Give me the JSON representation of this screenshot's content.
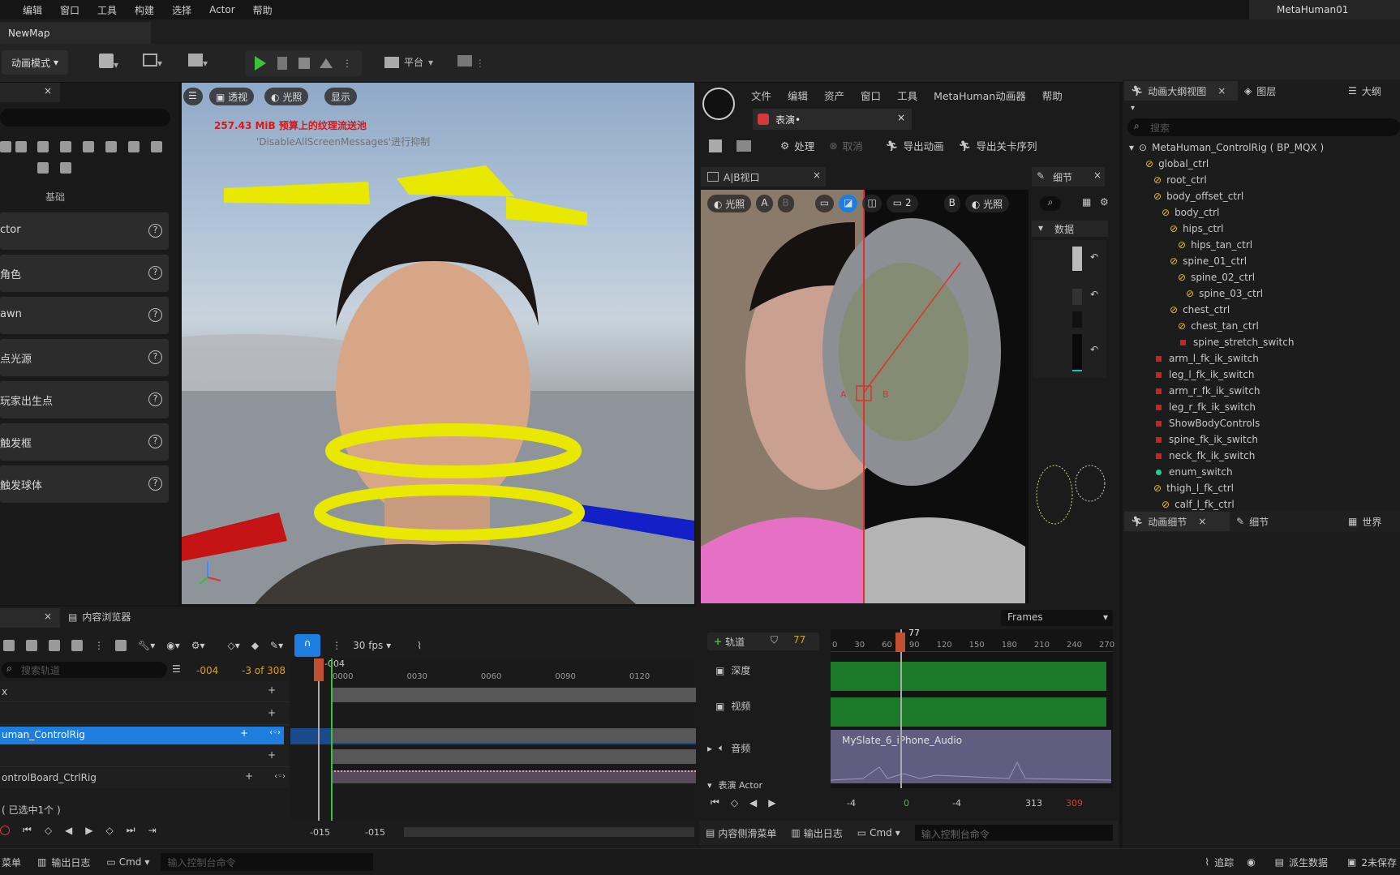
{
  "menu": [
    "编辑",
    "窗口",
    "工具",
    "构建",
    "选择",
    "Actor",
    "帮助"
  ],
  "app": {
    "map_tab": "NewMap",
    "project": "MetaHuman01"
  },
  "toolbar": {
    "mode": "动画模式",
    "platform": "平台"
  },
  "left_panel": {
    "section_label": "基础",
    "items": [
      "ctor",
      "角色",
      "awn",
      "点光源",
      "玩家出生点",
      "触发框",
      "触发球体"
    ],
    "help_glyph": "?"
  },
  "viewport": {
    "buttons": {
      "perspective": "透视",
      "lighting": "光照",
      "show": "显示"
    },
    "warning": "257.43 MiB 预算上的纹理流送池",
    "warning_sub": "'DisableAllScreenMessages'进行抑制"
  },
  "mh_window": {
    "menu": [
      "文件",
      "编辑",
      "资产",
      "窗口",
      "工具",
      "MetaHuman动画器",
      "帮助"
    ],
    "tab": "表演•",
    "toolbar": {
      "process": "处理",
      "cancel": "取消",
      "export_anim": "导出动画",
      "export_seq": "导出关卡序列"
    },
    "ab_tab": "A|B视口",
    "ab_buttons": {
      "lighting_a": "光照",
      "a": "A",
      "b_small": "B",
      "count": "2",
      "b": "B",
      "lighting_b": "光照"
    },
    "labels_ab": {
      "a": "A",
      "b": "B"
    },
    "details_tab": "细节",
    "details_section": "数据",
    "frames_dropdown": "Frames",
    "track_btn": "轨道",
    "frame_num": "77",
    "playhead": "77",
    "ticks": [
      "0",
      "30",
      "60",
      "90",
      "120",
      "150",
      "180",
      "210",
      "240",
      "270"
    ],
    "tracks": {
      "depth": "深度",
      "video": "视频",
      "audio": "音频",
      "actor": "表演 Actor"
    },
    "audio_clip": "MySlate_6_iPhone_Audio",
    "footer_vals": {
      "a": "-4",
      "b": "0",
      "c": "-4",
      "d": "313",
      "e": "309"
    },
    "bottom": {
      "content_menu": "内容侧滑菜单",
      "output_log": "输出日志",
      "cmd": "Cmd",
      "console_ph": "输入控制台命令"
    }
  },
  "outliner": {
    "tab1": "动画大纲视图",
    "tab2": "图层",
    "tab3": "大纲",
    "search_ph": "搜索",
    "root": "MetaHuman_ControlRig ( BP_MQX )",
    "items": [
      {
        "label": "global_ctrl",
        "indent": 1,
        "type": "ctrl"
      },
      {
        "label": "root_ctrl",
        "indent": 2,
        "type": "ctrl"
      },
      {
        "label": "body_offset_ctrl",
        "indent": 2,
        "type": "ctrl"
      },
      {
        "label": "body_ctrl",
        "indent": 3,
        "type": "ctrl"
      },
      {
        "label": "hips_ctrl",
        "indent": 4,
        "type": "ctrl"
      },
      {
        "label": "hips_tan_ctrl",
        "indent": 5,
        "type": "ctrl"
      },
      {
        "label": "spine_01_ctrl",
        "indent": 4,
        "type": "ctrl"
      },
      {
        "label": "spine_02_ctrl",
        "indent": 5,
        "type": "ctrl"
      },
      {
        "label": "spine_03_ctrl",
        "indent": 6,
        "type": "ctrl"
      },
      {
        "label": "chest_ctrl",
        "indent": 4,
        "type": "ctrl"
      },
      {
        "label": "chest_tan_ctrl",
        "indent": 5,
        "type": "ctrl"
      },
      {
        "label": "spine_stretch_switch",
        "indent": 5,
        "type": "red"
      },
      {
        "label": "arm_l_fk_ik_switch",
        "indent": 2,
        "type": "red"
      },
      {
        "label": "leg_l_fk_ik_switch",
        "indent": 2,
        "type": "red"
      },
      {
        "label": "arm_r_fk_ik_switch",
        "indent": 2,
        "type": "red"
      },
      {
        "label": "leg_r_fk_ik_switch",
        "indent": 2,
        "type": "red"
      },
      {
        "label": "ShowBodyControls",
        "indent": 2,
        "type": "red"
      },
      {
        "label": "spine_fk_ik_switch",
        "indent": 2,
        "type": "red"
      },
      {
        "label": "neck_fk_ik_switch",
        "indent": 2,
        "type": "red"
      },
      {
        "label": "enum_switch",
        "indent": 2,
        "type": "green"
      },
      {
        "label": "thigh_l_fk_ctrl",
        "indent": 2,
        "type": "ctrl"
      },
      {
        "label": "calf_l_fk_ctrl",
        "indent": 3,
        "type": "ctrl"
      }
    ],
    "details_tab1": "动画细节",
    "details_tab2": "细节",
    "details_tab3": "世界"
  },
  "sequencer": {
    "tab_content": "内容浏览器",
    "search_ph": "搜索轨道",
    "fps": "30 fps",
    "frame_val": "-004",
    "range_info": "-3 of 308",
    "playhead": "-004",
    "ticks": [
      "0000",
      "0030",
      "0060",
      "0090",
      "0120"
    ],
    "rows": [
      "x",
      "",
      "uman_ControlRig",
      "",
      "ontrolBoard_CtrlRig"
    ],
    "selected": "( 已选中1个 )",
    "bottom_vals": [
      "-015",
      "-015"
    ]
  },
  "status": {
    "menu": "菜单",
    "output_log": "输出日志",
    "cmd": "Cmd",
    "console_ph": "输入控制台命令",
    "trace": "追踪",
    "derived": "派生数据",
    "unsaved": "2未保存"
  },
  "colors": {
    "accent": "#1d7ee0",
    "gizmo_yellow": "#e8e800",
    "record_red": "#e03030",
    "green": "#1f8a2a"
  }
}
